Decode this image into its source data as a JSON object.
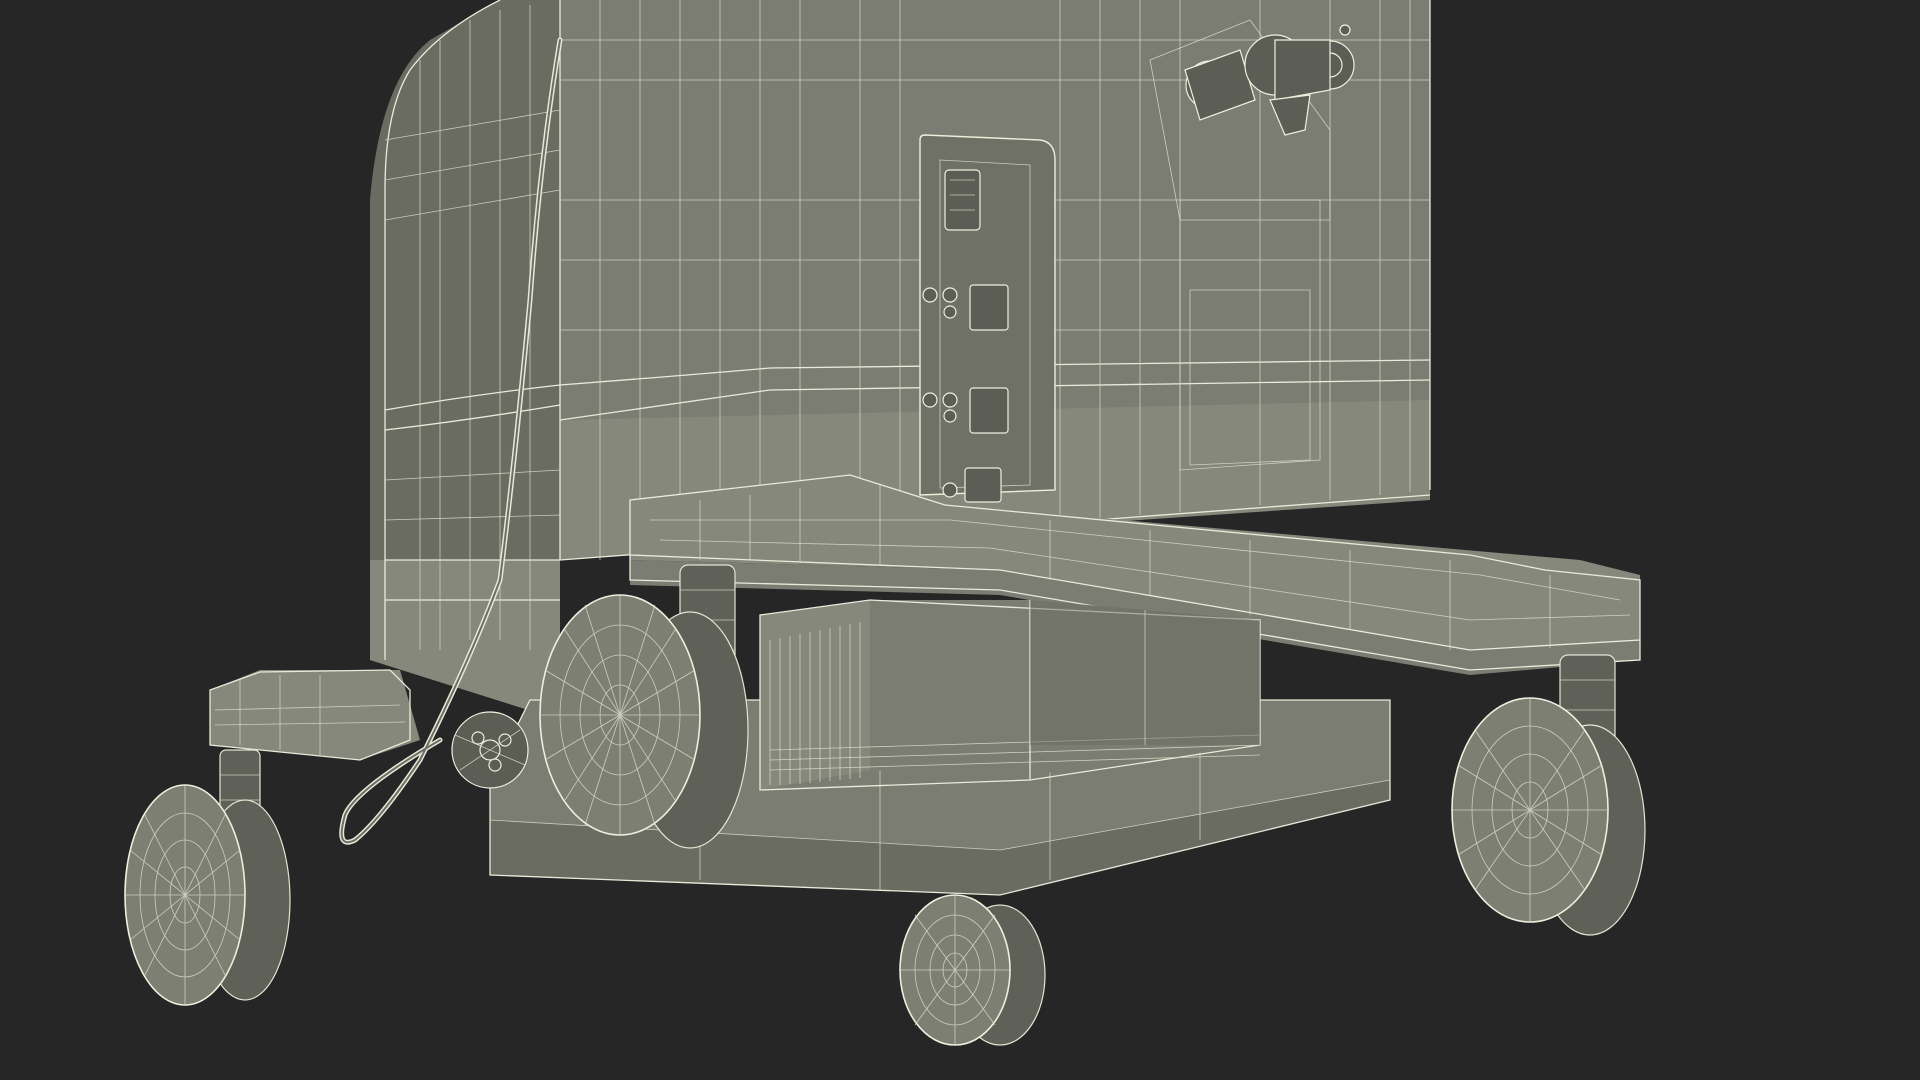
{
  "scene": {
    "background_color": "#262626",
    "model_color": "#7b7d72",
    "wire_color": "#e9ead9"
  },
  "wheels": [
    {
      "id": "front-left"
    },
    {
      "id": "front-center"
    },
    {
      "id": "rear-left"
    },
    {
      "id": "rear-right"
    }
  ]
}
